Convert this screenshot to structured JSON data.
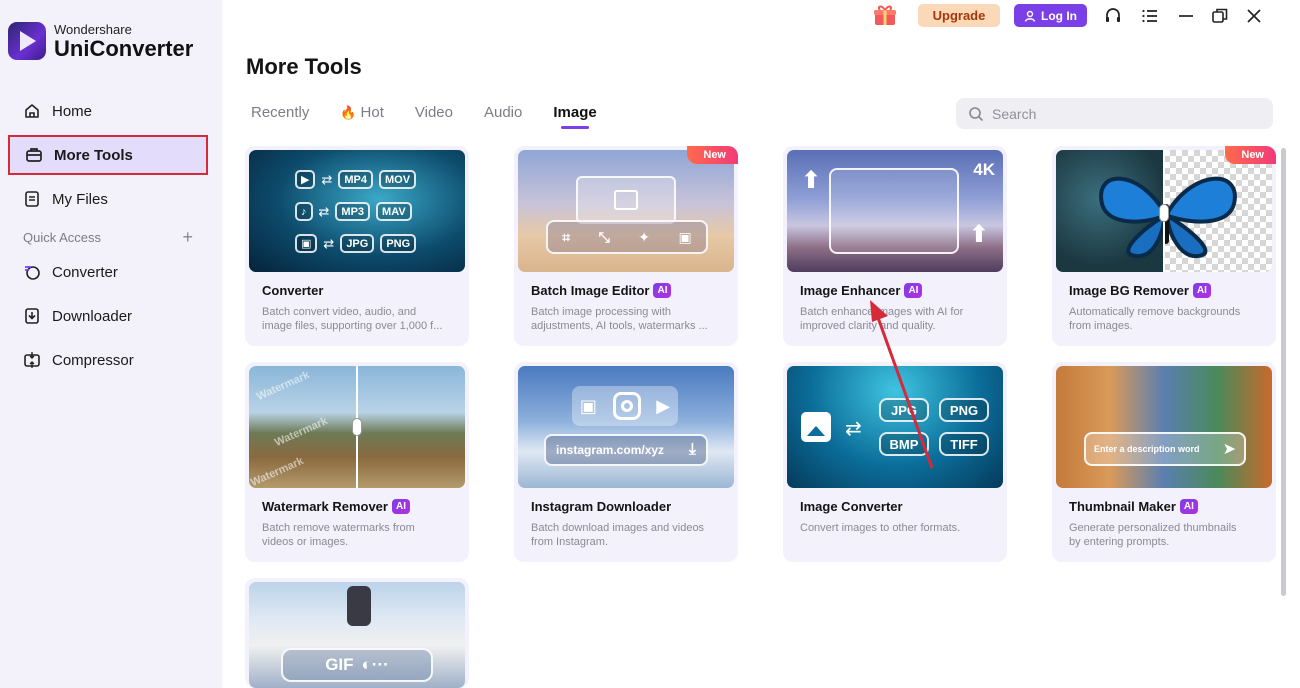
{
  "brand": {
    "small": "Wondershare",
    "big": "UniConverter"
  },
  "sidebar": {
    "items": [
      {
        "label": "Home",
        "icon": "home-icon"
      },
      {
        "label": "More Tools",
        "icon": "toolbox-icon",
        "active": true
      },
      {
        "label": "My Files",
        "icon": "file-icon"
      }
    ],
    "quick_access_label": "Quick Access",
    "quick_items": [
      {
        "label": "Converter",
        "icon": "converter-icon"
      },
      {
        "label": "Downloader",
        "icon": "downloader-icon"
      },
      {
        "label": "Compressor",
        "icon": "compressor-icon"
      }
    ]
  },
  "topbar": {
    "upgrade": "Upgrade",
    "login": "Log In"
  },
  "page_title": "More Tools",
  "tabs": [
    "Recently",
    "Hot",
    "Video",
    "Audio",
    "Image"
  ],
  "active_tab": "Image",
  "search": {
    "placeholder": "Search"
  },
  "cards": [
    {
      "title": "Converter",
      "ai": false,
      "desc": "Batch convert video, audio, and\nimage files, supporting over 1,000 f...",
      "pills": [
        "MP4",
        "MOV",
        "MP3",
        "MAV",
        "JPG",
        "PNG"
      ]
    },
    {
      "title": "Batch Image Editor",
      "ai": true,
      "new": "New",
      "desc": "Batch image processing with\nadjustments, AI tools, watermarks ..."
    },
    {
      "title": "Image Enhancer",
      "ai": true,
      "badge": "4K",
      "desc": "Batch enhance images with AI for\nimproved clarity and quality."
    },
    {
      "title": "Image BG Remover",
      "ai": true,
      "new": "New",
      "desc": "Automatically remove backgrounds\nfrom images."
    },
    {
      "title": "Watermark Remover",
      "ai": true,
      "desc": "Batch remove watermarks from\nvideos or images.",
      "watermark_text": "Watermark"
    },
    {
      "title": "Instagram Downloader",
      "ai": false,
      "desc": "Batch download images and videos\nfrom Instagram.",
      "url": "instagram.com/xyz"
    },
    {
      "title": "Image Converter",
      "ai": false,
      "desc": "Convert images to other formats.",
      "pills": [
        "JPG",
        "PNG",
        "BMP",
        "TIFF"
      ]
    },
    {
      "title": "Thumbnail Maker",
      "ai": true,
      "desc": "Generate personalized thumbnails\nby entering prompts.",
      "prompt": "Enter a description word"
    },
    {
      "title": "",
      "ai": false,
      "desc": "",
      "gif_label": "GIF"
    }
  ],
  "ai_label": "AI",
  "colors": {
    "accent": "#7b3fe8",
    "highlight": "#d42a3a",
    "sidebar_bg": "#f3f2fa",
    "card_bg": "#f3f1fc"
  }
}
